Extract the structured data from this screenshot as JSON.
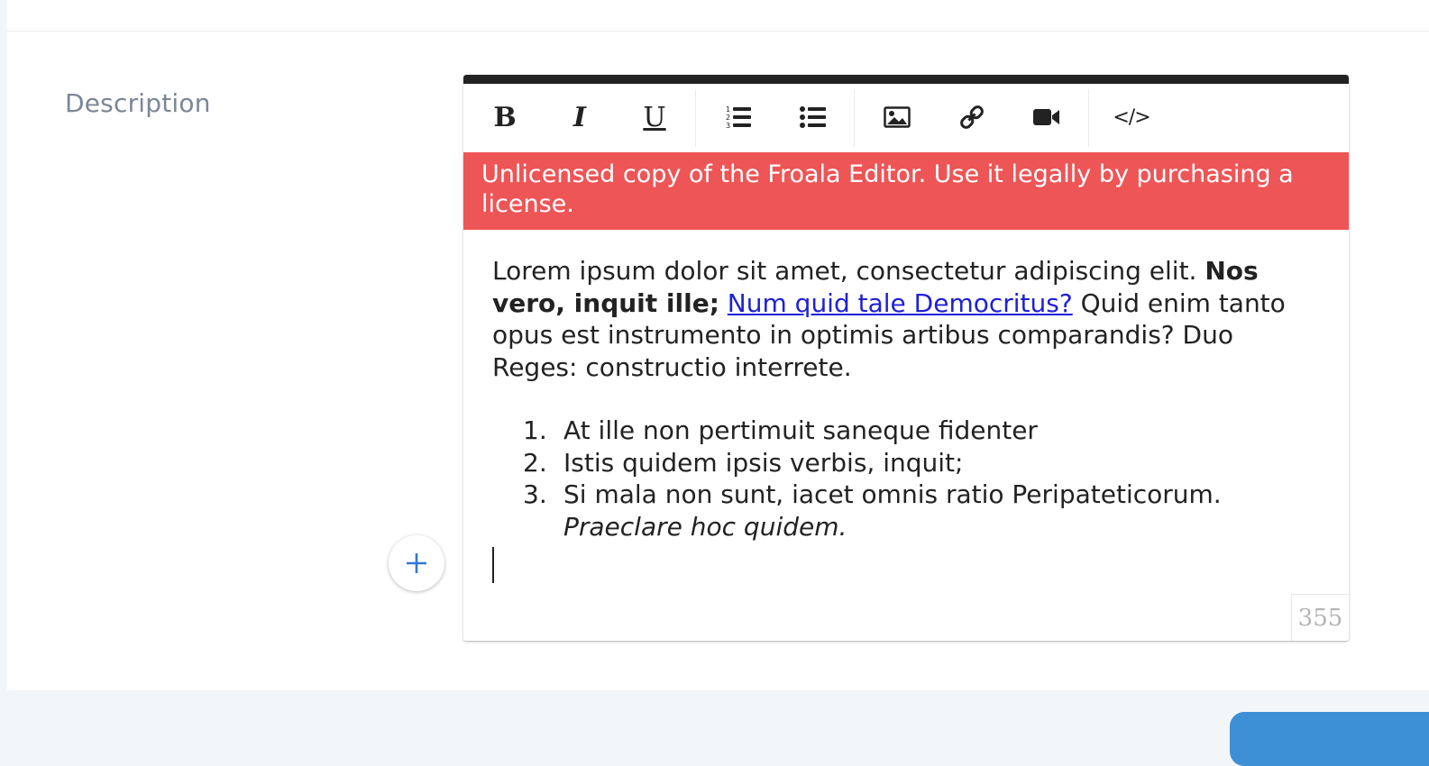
{
  "form": {
    "description_label": "Description"
  },
  "toolbar": {
    "buttons": [
      {
        "name": "bold",
        "icon": "bold-icon",
        "glyph": "B"
      },
      {
        "name": "italic",
        "icon": "italic-icon",
        "glyph": "I"
      },
      {
        "name": "underline",
        "icon": "underline-icon",
        "glyph": "U"
      },
      {
        "name": "ordered-list",
        "icon": "ordered-list-icon"
      },
      {
        "name": "unordered-list",
        "icon": "unordered-list-icon"
      },
      {
        "name": "insert-image",
        "icon": "image-icon"
      },
      {
        "name": "insert-link",
        "icon": "link-icon"
      },
      {
        "name": "insert-video",
        "icon": "video-camera-icon"
      },
      {
        "name": "code-view",
        "icon": "code-icon",
        "glyph": "</>"
      }
    ]
  },
  "editor": {
    "license_banner": "Unlicensed copy of the Froala Editor. Use it legally by purchasing a license.",
    "paragraph": {
      "text_1": "Lorem ipsum dolor sit amet, consectetur adipiscing elit. ",
      "bold": "Nos vero, inquit ille;",
      "text_2": " ",
      "link": "Num quid tale Democritus?",
      "text_3": " Quid enim tanto opus est instrumento in optimis artibus comparandis? Duo Reges: constructio interrete."
    },
    "ordered_list": [
      {
        "number": "1.",
        "text": "At ille non pertimuit saneque fidenter"
      },
      {
        "number": "2.",
        "text": "Istis quidem ipsis verbis, inquit;"
      },
      {
        "number": "3.",
        "text": "Si mala non sunt, iacet omnis ratio Peripateticorum. ",
        "italic": "Praeclare hoc quidem."
      }
    ],
    "char_count": "355"
  },
  "colors": {
    "license_banner": "#ee5556",
    "link": "#1e21d6",
    "accent_blue": "#3d8fd6"
  }
}
